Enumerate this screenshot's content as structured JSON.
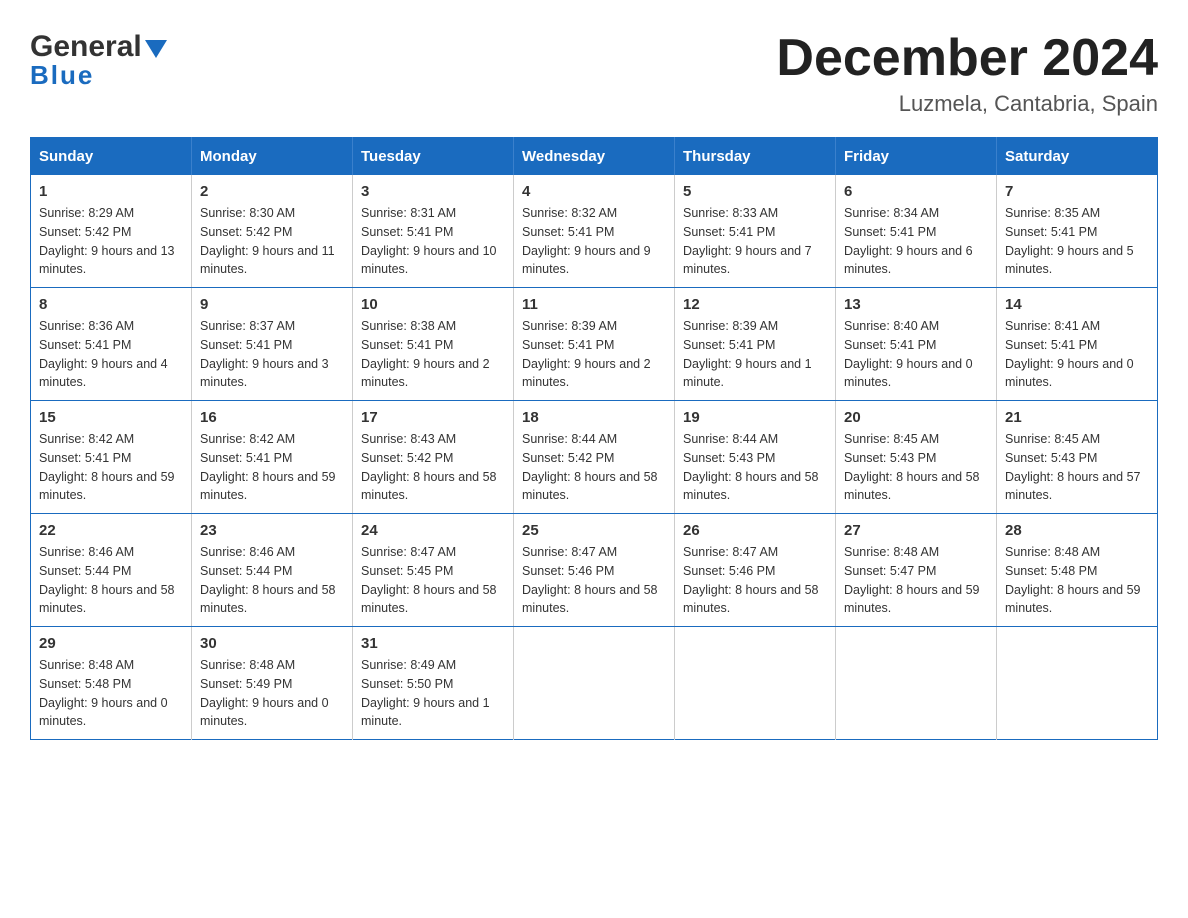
{
  "logo": {
    "name_black": "General",
    "name_blue": "Blue"
  },
  "title": {
    "month_year": "December 2024",
    "location": "Luzmela, Cantabria, Spain"
  },
  "weekdays": [
    "Sunday",
    "Monday",
    "Tuesday",
    "Wednesday",
    "Thursday",
    "Friday",
    "Saturday"
  ],
  "weeks": [
    [
      {
        "day": "1",
        "sunrise": "8:29 AM",
        "sunset": "5:42 PM",
        "daylight": "9 hours and 13 minutes."
      },
      {
        "day": "2",
        "sunrise": "8:30 AM",
        "sunset": "5:42 PM",
        "daylight": "9 hours and 11 minutes."
      },
      {
        "day": "3",
        "sunrise": "8:31 AM",
        "sunset": "5:41 PM",
        "daylight": "9 hours and 10 minutes."
      },
      {
        "day": "4",
        "sunrise": "8:32 AM",
        "sunset": "5:41 PM",
        "daylight": "9 hours and 9 minutes."
      },
      {
        "day": "5",
        "sunrise": "8:33 AM",
        "sunset": "5:41 PM",
        "daylight": "9 hours and 7 minutes."
      },
      {
        "day": "6",
        "sunrise": "8:34 AM",
        "sunset": "5:41 PM",
        "daylight": "9 hours and 6 minutes."
      },
      {
        "day": "7",
        "sunrise": "8:35 AM",
        "sunset": "5:41 PM",
        "daylight": "9 hours and 5 minutes."
      }
    ],
    [
      {
        "day": "8",
        "sunrise": "8:36 AM",
        "sunset": "5:41 PM",
        "daylight": "9 hours and 4 minutes."
      },
      {
        "day": "9",
        "sunrise": "8:37 AM",
        "sunset": "5:41 PM",
        "daylight": "9 hours and 3 minutes."
      },
      {
        "day": "10",
        "sunrise": "8:38 AM",
        "sunset": "5:41 PM",
        "daylight": "9 hours and 2 minutes."
      },
      {
        "day": "11",
        "sunrise": "8:39 AM",
        "sunset": "5:41 PM",
        "daylight": "9 hours and 2 minutes."
      },
      {
        "day": "12",
        "sunrise": "8:39 AM",
        "sunset": "5:41 PM",
        "daylight": "9 hours and 1 minute."
      },
      {
        "day": "13",
        "sunrise": "8:40 AM",
        "sunset": "5:41 PM",
        "daylight": "9 hours and 0 minutes."
      },
      {
        "day": "14",
        "sunrise": "8:41 AM",
        "sunset": "5:41 PM",
        "daylight": "9 hours and 0 minutes."
      }
    ],
    [
      {
        "day": "15",
        "sunrise": "8:42 AM",
        "sunset": "5:41 PM",
        "daylight": "8 hours and 59 minutes."
      },
      {
        "day": "16",
        "sunrise": "8:42 AM",
        "sunset": "5:41 PM",
        "daylight": "8 hours and 59 minutes."
      },
      {
        "day": "17",
        "sunrise": "8:43 AM",
        "sunset": "5:42 PM",
        "daylight": "8 hours and 58 minutes."
      },
      {
        "day": "18",
        "sunrise": "8:44 AM",
        "sunset": "5:42 PM",
        "daylight": "8 hours and 58 minutes."
      },
      {
        "day": "19",
        "sunrise": "8:44 AM",
        "sunset": "5:43 PM",
        "daylight": "8 hours and 58 minutes."
      },
      {
        "day": "20",
        "sunrise": "8:45 AM",
        "sunset": "5:43 PM",
        "daylight": "8 hours and 58 minutes."
      },
      {
        "day": "21",
        "sunrise": "8:45 AM",
        "sunset": "5:43 PM",
        "daylight": "8 hours and 57 minutes."
      }
    ],
    [
      {
        "day": "22",
        "sunrise": "8:46 AM",
        "sunset": "5:44 PM",
        "daylight": "8 hours and 58 minutes."
      },
      {
        "day": "23",
        "sunrise": "8:46 AM",
        "sunset": "5:44 PM",
        "daylight": "8 hours and 58 minutes."
      },
      {
        "day": "24",
        "sunrise": "8:47 AM",
        "sunset": "5:45 PM",
        "daylight": "8 hours and 58 minutes."
      },
      {
        "day": "25",
        "sunrise": "8:47 AM",
        "sunset": "5:46 PM",
        "daylight": "8 hours and 58 minutes."
      },
      {
        "day": "26",
        "sunrise": "8:47 AM",
        "sunset": "5:46 PM",
        "daylight": "8 hours and 58 minutes."
      },
      {
        "day": "27",
        "sunrise": "8:48 AM",
        "sunset": "5:47 PM",
        "daylight": "8 hours and 59 minutes."
      },
      {
        "day": "28",
        "sunrise": "8:48 AM",
        "sunset": "5:48 PM",
        "daylight": "8 hours and 59 minutes."
      }
    ],
    [
      {
        "day": "29",
        "sunrise": "8:48 AM",
        "sunset": "5:48 PM",
        "daylight": "9 hours and 0 minutes."
      },
      {
        "day": "30",
        "sunrise": "8:48 AM",
        "sunset": "5:49 PM",
        "daylight": "9 hours and 0 minutes."
      },
      {
        "day": "31",
        "sunrise": "8:49 AM",
        "sunset": "5:50 PM",
        "daylight": "9 hours and 1 minute."
      },
      null,
      null,
      null,
      null
    ]
  ]
}
